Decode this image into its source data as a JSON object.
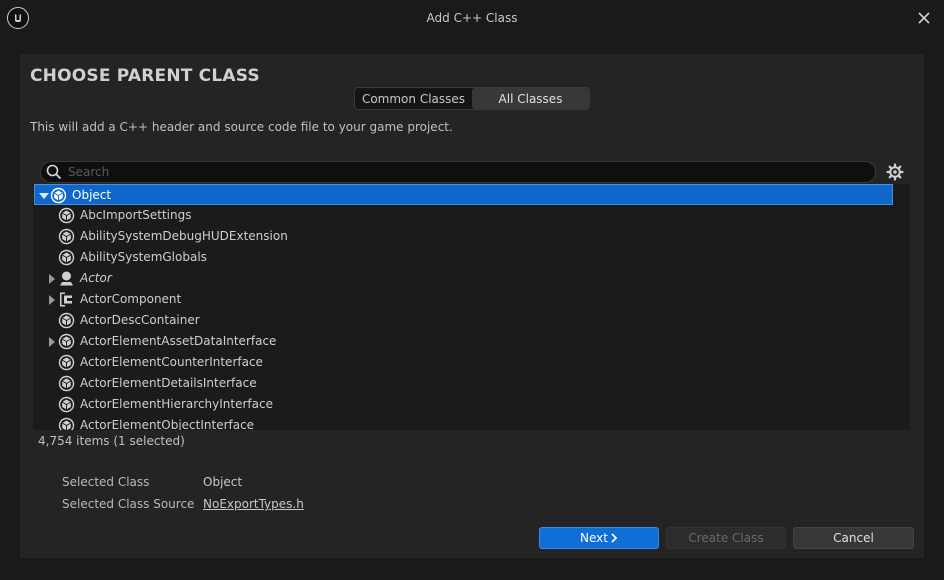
{
  "window": {
    "title": "Add C++ Class"
  },
  "heading": "CHOOSE PARENT CLASS",
  "tabs": [
    {
      "label": "Common Classes",
      "active": false
    },
    {
      "label": "All Classes",
      "active": true
    }
  ],
  "description": "This will add a C++ header and source code file to your game project.",
  "search": {
    "placeholder": "Search",
    "value": ""
  },
  "tree": {
    "items": [
      {
        "label": "Object",
        "icon": "object-class-icon",
        "expander": "expanded",
        "selected": true,
        "italic": false,
        "level": 0
      },
      {
        "label": "AbcImportSettings",
        "icon": "object-class-icon",
        "expander": "none",
        "selected": false,
        "italic": false,
        "level": 1
      },
      {
        "label": "AbilitySystemDebugHUDExtension",
        "icon": "object-class-icon",
        "expander": "none",
        "selected": false,
        "italic": false,
        "level": 1
      },
      {
        "label": "AbilitySystemGlobals",
        "icon": "object-class-icon",
        "expander": "none",
        "selected": false,
        "italic": false,
        "level": 1
      },
      {
        "label": "Actor",
        "icon": "actor-class-icon",
        "expander": "collapsed",
        "selected": false,
        "italic": true,
        "level": 1
      },
      {
        "label": "ActorComponent",
        "icon": "component-class-icon",
        "expander": "collapsed",
        "selected": false,
        "italic": false,
        "level": 1
      },
      {
        "label": "ActorDescContainer",
        "icon": "object-class-icon",
        "expander": "none",
        "selected": false,
        "italic": false,
        "level": 1
      },
      {
        "label": "ActorElementAssetDataInterface",
        "icon": "object-class-icon",
        "expander": "collapsed",
        "selected": false,
        "italic": false,
        "level": 1
      },
      {
        "label": "ActorElementCounterInterface",
        "icon": "object-class-icon",
        "expander": "none",
        "selected": false,
        "italic": false,
        "level": 1
      },
      {
        "label": "ActorElementDetailsInterface",
        "icon": "object-class-icon",
        "expander": "none",
        "selected": false,
        "italic": false,
        "level": 1
      },
      {
        "label": "ActorElementHierarchyInterface",
        "icon": "object-class-icon",
        "expander": "none",
        "selected": false,
        "italic": false,
        "level": 1
      },
      {
        "label": "ActorElementObjectInterface",
        "icon": "object-class-icon",
        "expander": "none",
        "selected": false,
        "italic": false,
        "level": 1
      }
    ]
  },
  "status": {
    "count": "4,754 items (1 selected)"
  },
  "details": {
    "selected_class_label": "Selected Class",
    "selected_class_value": "Object",
    "source_label": "Selected Class Source",
    "source_value": "NoExportTypes.h"
  },
  "buttons": {
    "next": "Next",
    "create": "Create Class",
    "cancel": "Cancel"
  },
  "colors": {
    "selection": "#0f68c9",
    "primary_button": "#0e6fd6",
    "background": "#1a1a1a",
    "panel": "#242424"
  }
}
